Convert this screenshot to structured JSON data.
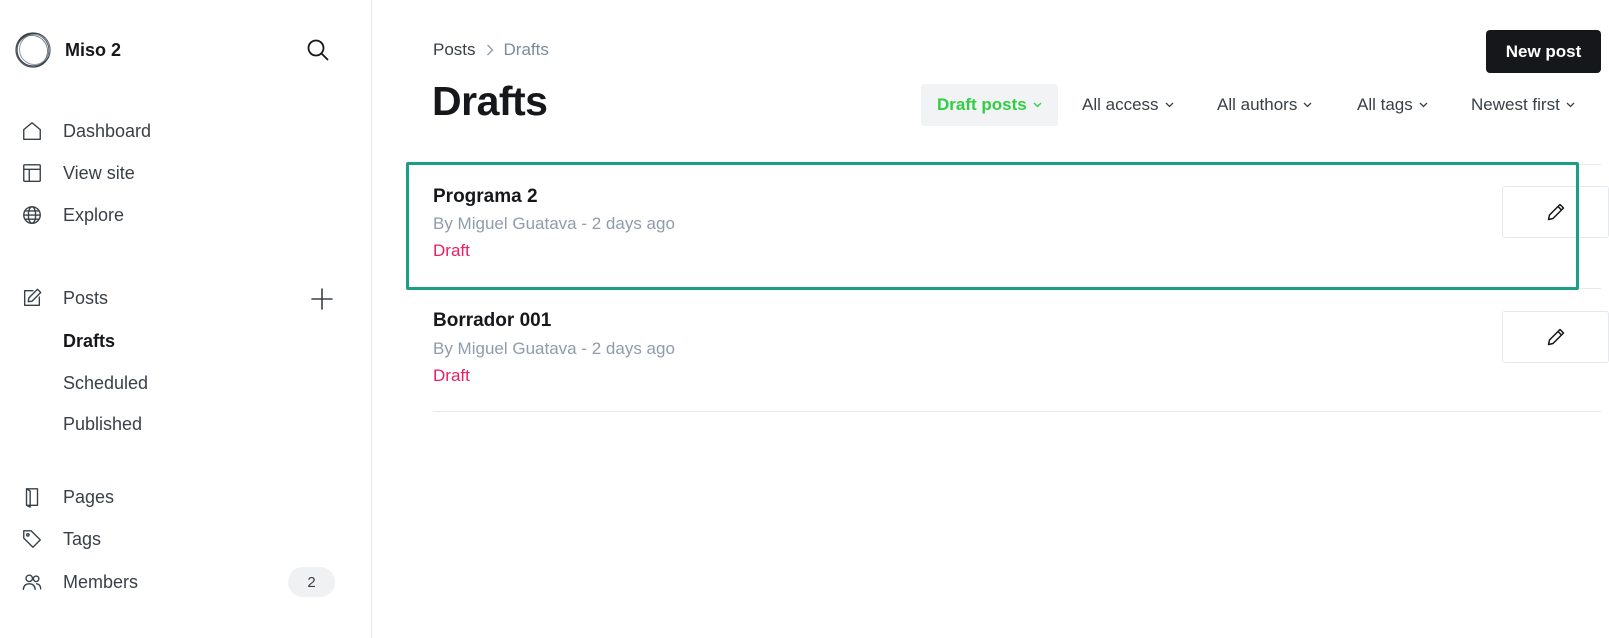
{
  "brand": {
    "name": "Miso 2"
  },
  "sidebar": {
    "primary": [
      {
        "id": "dashboard",
        "label": "Dashboard",
        "icon": "home-icon"
      },
      {
        "id": "view-site",
        "label": "View site",
        "icon": "layout-icon"
      },
      {
        "id": "explore",
        "label": "Explore",
        "icon": "globe-icon"
      }
    ],
    "posts": {
      "label": "Posts",
      "icon": "pencil-square-icon",
      "sub_items": [
        {
          "label": "Drafts",
          "active": true
        },
        {
          "label": "Scheduled",
          "active": false
        },
        {
          "label": "Published",
          "active": false
        }
      ]
    },
    "secondary": [
      {
        "id": "pages",
        "label": "Pages",
        "icon": "page-icon"
      },
      {
        "id": "tags",
        "label": "Tags",
        "icon": "tag-icon"
      },
      {
        "id": "members",
        "label": "Members",
        "icon": "members-icon",
        "badge": "2"
      }
    ]
  },
  "breadcrumb": {
    "root": "Posts",
    "current": "Drafts"
  },
  "page_title": "Drafts",
  "new_post_label": "New post",
  "filters": {
    "type": "Draft posts",
    "access": "All access",
    "authors": "All authors",
    "tags": "All tags",
    "sort": "Newest first"
  },
  "posts": [
    {
      "title": "Programa 2",
      "meta": "By Miguel Guatava - 2 days ago",
      "status": "Draft"
    },
    {
      "title": "Borrador 001",
      "meta": "By Miguel Guatava - 2 days ago",
      "status": "Draft"
    }
  ],
  "colors": {
    "accent_green": "#30cf43",
    "draft_pink": "#e91e63",
    "highlight_teal": "#1a9e86",
    "primary_button": "#15171a"
  }
}
